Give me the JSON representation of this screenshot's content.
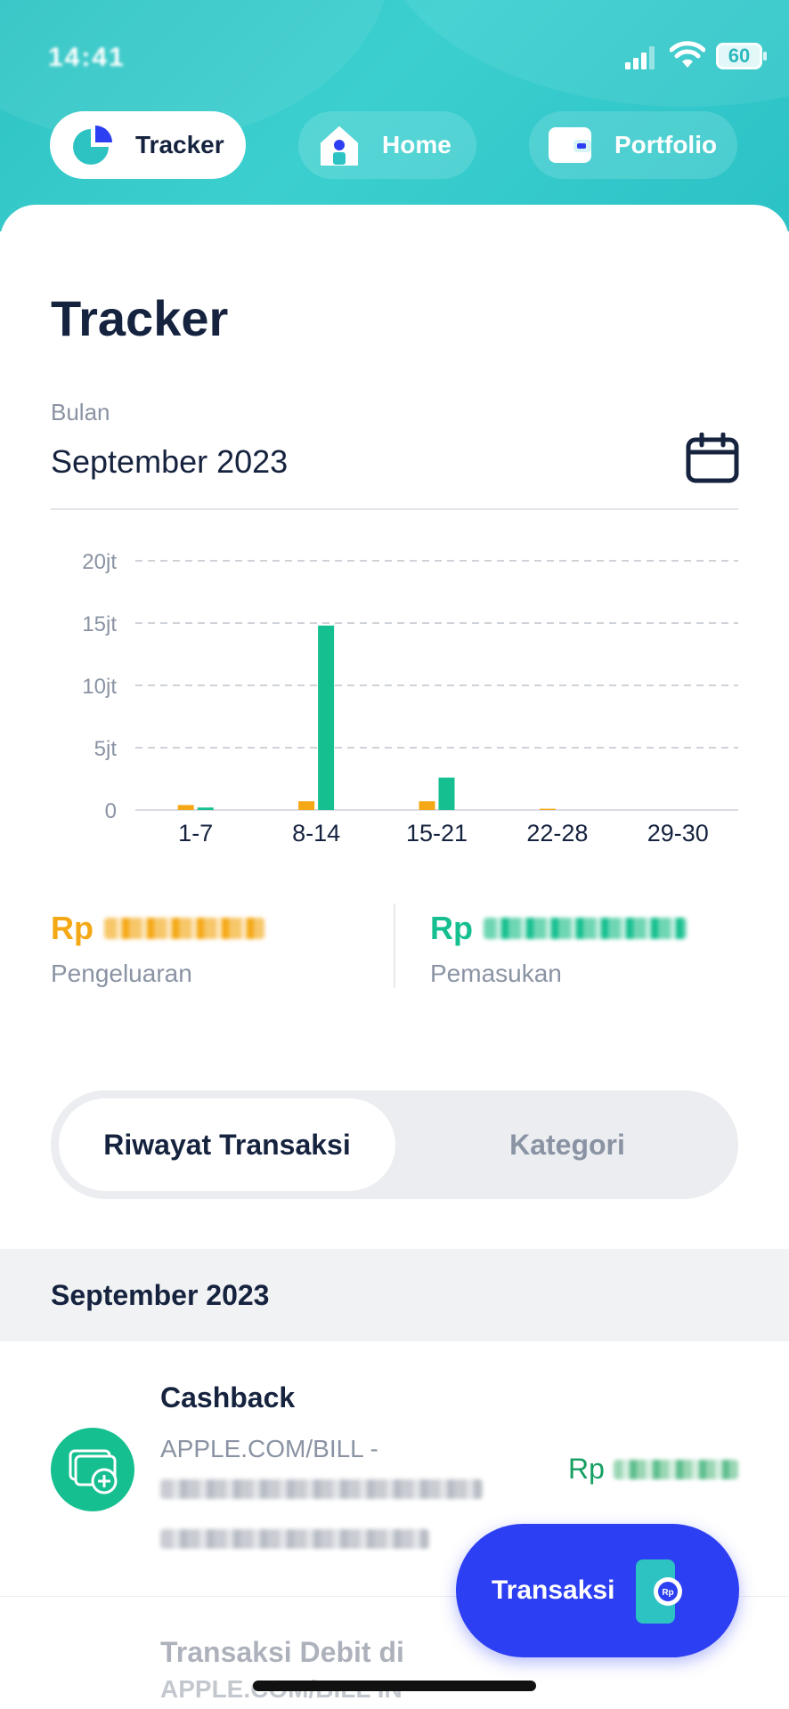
{
  "status_bar": {
    "time": "14:41",
    "battery": "60"
  },
  "nav": {
    "tracker_label": "Tracker",
    "home_label": "Home",
    "portfolio_label": "Portfolio"
  },
  "page": {
    "title": "Tracker",
    "month_label": "Bulan",
    "month_value": "September 2023"
  },
  "chart_data": {
    "type": "bar",
    "categories": [
      "1-7",
      "8-14",
      "15-21",
      "22-28",
      "29-30"
    ],
    "series": [
      {
        "name": "Pengeluaran",
        "color": "#f5a815",
        "values": [
          0.4,
          0.7,
          0.7,
          0.1,
          0
        ]
      },
      {
        "name": "Pemasukan",
        "color": "#15bf8f",
        "values": [
          0.2,
          14.8,
          2.6,
          0,
          0
        ]
      }
    ],
    "yticks": [
      "0",
      "5jt",
      "10jt",
      "15jt",
      "20jt"
    ],
    "ylim": [
      0,
      20
    ],
    "unit": "jt",
    "grid": true
  },
  "summary": {
    "expense_currency": "Rp",
    "expense_label": "Pengeluaran",
    "income_currency": "Rp",
    "income_label": "Pemasukan"
  },
  "segment": {
    "active_label": "Riwayat Transaksi",
    "inactive_label": "Kategori"
  },
  "section": {
    "title": "September 2023"
  },
  "transactions": [
    {
      "title": "Cashback",
      "desc": "APPLE.COM/BILL -",
      "amount_currency": "Rp",
      "type": "income"
    },
    {
      "title": "Transaksi Debit di",
      "desc": "APPLE.COM/BILL IN"
    }
  ],
  "fab": {
    "label": "Transaksi"
  },
  "colors": {
    "accent": "#2d3ff2",
    "brand_teal": "#2ec3c3",
    "income": "#15bf8f",
    "expense": "#f5a815",
    "text": "#16233f"
  }
}
